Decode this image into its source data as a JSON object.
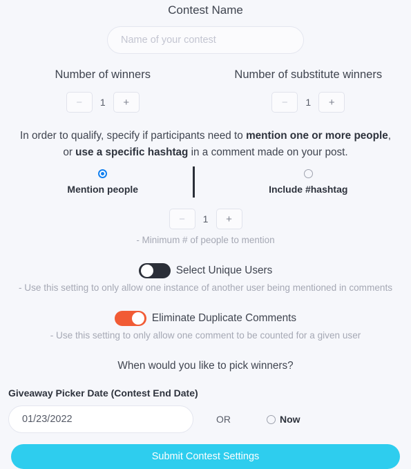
{
  "contest": {
    "title": "Contest Name",
    "name_value": "",
    "name_placeholder": "Name of your contest"
  },
  "winners": {
    "label": "Number of winners",
    "minus_label": "−",
    "plus_label": "+",
    "value": "1"
  },
  "substitutes": {
    "label": "Number of substitute winners",
    "minus_label": "−",
    "plus_label": "+",
    "value": "1"
  },
  "qualify": {
    "line1_part1": "In order to qualify, specify if participants need to ",
    "line1_bold": "mention one or more people",
    "line1_part2": ",",
    "line2_part1": "or ",
    "line2_bold": "use a specific hashtag",
    "line2_part2": " in a comment made on your post."
  },
  "choices": {
    "mention": {
      "label": "Mention people",
      "selected": true
    },
    "hashtag": {
      "label": "Include #hashtag",
      "selected": false
    }
  },
  "mention_count": {
    "minus_label": "−",
    "plus_label": "+",
    "value": "1",
    "note": "- Minimum # of people to mention"
  },
  "unique_users": {
    "label": "Select Unique Users",
    "state": "off",
    "note": "- Use this setting to only allow one instance of another user being mentioned in comments"
  },
  "duplicate_comments": {
    "label": "Eliminate Duplicate Comments",
    "state": "on",
    "note": "- Use this setting to only allow one comment to be counted for a given user"
  },
  "when_question": "When would you like to pick winners?",
  "date_section": {
    "label": "Giveaway Picker Date (Contest End Date)",
    "value": "01/23/2022",
    "or_text": "OR",
    "now_label": "Now",
    "now_selected": false
  },
  "submit": {
    "label": "Submit Contest Settings"
  },
  "colors": {
    "background": "#f6f7fb",
    "accent_submit": "#2ecdee",
    "toggle_on": "#f15b35",
    "toggle_off": "#2b2f38",
    "radio_selected": "#1380ef"
  }
}
